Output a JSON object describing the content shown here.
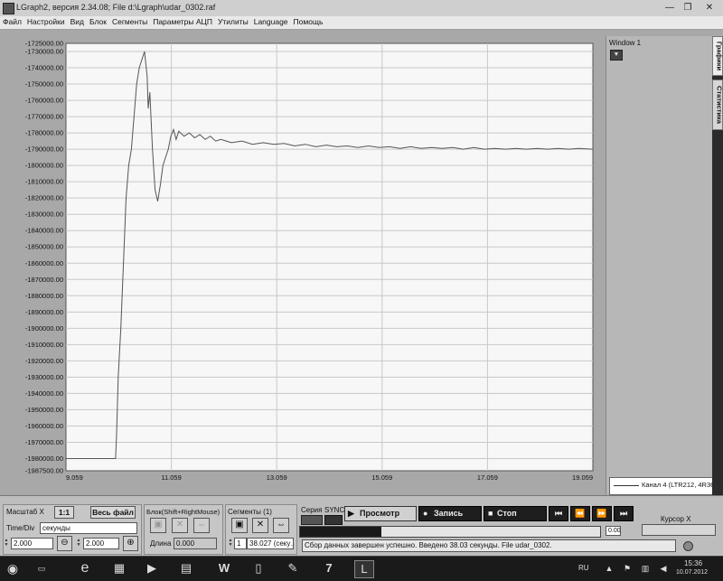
{
  "window": {
    "title": "LGraph2, версия  2.34.08; File d:\\Lgraph\\udar_0302.raf",
    "minimize_glyph": "—",
    "maximize_glyph": "❐",
    "close_glyph": "✕"
  },
  "menu": [
    "Файл",
    "Настройки",
    "Вид",
    "Блок",
    "Сегменты",
    "Параметры АЦП",
    "Утилиты",
    "Language",
    "Помощь"
  ],
  "right_panel": {
    "window_label": "Window 1",
    "tabs": [
      "Графики",
      "Статистика"
    ],
    "legend_entry": "Канал 4 (LTR212, 4R369…"
  },
  "chart_data": {
    "type": "line",
    "title": "",
    "xlabel": "",
    "ylabel": "",
    "xlim": [
      9.059,
      19.059
    ],
    "ylim": [
      -1987500,
      -1725000
    ],
    "x_ticks": [
      "9.059",
      "11.059",
      "13.059",
      "15.059",
      "17.059",
      "19.059"
    ],
    "y_ticks": [
      "-1725000.00",
      "-1730000.00",
      "-1740000.00",
      "-1750000.00",
      "-1760000.00",
      "-1770000.00",
      "-1780000.00",
      "-1790000.00",
      "-1800000.00",
      "-1810000.00",
      "-1820000.00",
      "-1830000.00",
      "-1840000.00",
      "-1850000.00",
      "-1860000.00",
      "-1870000.00",
      "-1880000.00",
      "-1890000.00",
      "-1900000.00",
      "-1910000.00",
      "-1920000.00",
      "-1930000.00",
      "-1940000.00",
      "-1950000.00",
      "-1960000.00",
      "-1970000.00",
      "-1980000.00",
      "-1987500.00"
    ],
    "grid": true,
    "line_color": "#555555",
    "series": [
      {
        "name": "Канал 4 (LTR212, 4R369…",
        "x": [
          9.059,
          9.4,
          9.8,
          10.0,
          10.02,
          10.05,
          10.1,
          10.15,
          10.2,
          10.25,
          10.3,
          10.35,
          10.4,
          10.45,
          10.5,
          10.55,
          10.6,
          10.62,
          10.65,
          10.7,
          10.75,
          10.8,
          10.85,
          10.9,
          10.95,
          11.0,
          11.05,
          11.1,
          11.15,
          11.2,
          11.3,
          11.4,
          11.5,
          11.6,
          11.7,
          11.8,
          11.9,
          12.0,
          12.2,
          12.4,
          12.6,
          12.8,
          13.0,
          13.2,
          13.4,
          13.6,
          13.8,
          14.0,
          14.2,
          14.4,
          14.6,
          14.8,
          15.0,
          15.2,
          15.4,
          15.6,
          15.8,
          16.0,
          16.2,
          16.4,
          16.6,
          16.8,
          17.0,
          17.2,
          17.4,
          17.6,
          17.8,
          18.0,
          18.2,
          18.4,
          18.6,
          18.8,
          19.059
        ],
        "y": [
          -1980000,
          -1980000,
          -1980000,
          -1980000,
          -1965000,
          -1930000,
          -1900000,
          -1860000,
          -1820000,
          -1800000,
          -1790000,
          -1770000,
          -1750000,
          -1740000,
          -1735000,
          -1730000,
          -1745000,
          -1765000,
          -1755000,
          -1790000,
          -1815000,
          -1822000,
          -1812000,
          -1800000,
          -1795000,
          -1790000,
          -1782000,
          -1778000,
          -1784000,
          -1779000,
          -1782000,
          -1780000,
          -1783000,
          -1781000,
          -1784000,
          -1782000,
          -1785000,
          -1784000,
          -1786000,
          -1785000,
          -1787000,
          -1786000,
          -1787000,
          -1786500,
          -1788000,
          -1787000,
          -1788500,
          -1787500,
          -1788500,
          -1788000,
          -1789000,
          -1788000,
          -1789000,
          -1788500,
          -1789500,
          -1788500,
          -1789500,
          -1789000,
          -1789500,
          -1789000,
          -1790000,
          -1789000,
          -1790000,
          -1789500,
          -1790000,
          -1789500,
          -1790000,
          -1789500,
          -1790000,
          -1789500,
          -1790000,
          -1789500,
          -1790000
        ]
      }
    ]
  },
  "controls": {
    "scale_x_label": "Масштаб X",
    "one_to_one": "1:1",
    "whole_file": "Весь файл",
    "time_div_label": "Time/Div",
    "time_unit": "секунды",
    "time_div_value": "2.000",
    "zoom_value": "2.000",
    "block_title": "Блок(Shift+RightMouse)",
    "length_label": "Длина",
    "length_value": "0.000",
    "segments_title": "Сегменты (1)",
    "segment_number": "1",
    "segment_value": "38.027 (секу…",
    "series_label": "Серия",
    "sync_label": "SYNC",
    "view_button": "Просмотр",
    "record_button": "Запись",
    "stop_button": "Стоп",
    "progress_value": "0.00",
    "progress_fraction": 0.27,
    "cursor_label": "Курсор X",
    "status_text": "Сбор данных завершен успешно. Введено 38.03 секунды. File udar_0302."
  },
  "taskbar": {
    "lang": "RU",
    "time": "15:36",
    "date": "10.07.2012"
  }
}
